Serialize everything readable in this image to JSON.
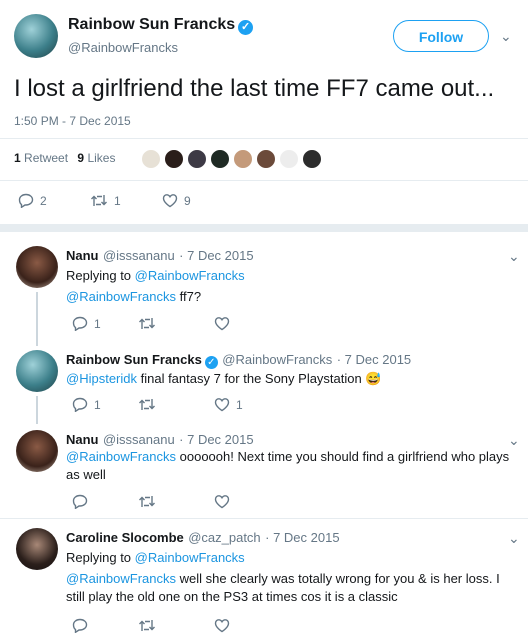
{
  "main_tweet": {
    "display_name": "Rainbow Sun Francks",
    "handle": "@RainbowFrancks",
    "follow_label": "Follow",
    "text": "I lost a girlfriend the last time FF7 came out...",
    "timestamp": "1:50 PM - 7 Dec 2015",
    "retweets_count": "1",
    "retweets_label": "Retweet",
    "likes_count": "9",
    "likes_label": "Likes",
    "actions": {
      "reply": "2",
      "retweet": "1",
      "like": "9"
    }
  },
  "replies": [
    {
      "display_name": "Nanu",
      "handle": "@isssananu",
      "date": "· 7 Dec 2015",
      "replying_prefix": "Replying to",
      "replying_to": "@RainbowFrancks",
      "mention": "@RainbowFrancks",
      "text": " ff7?",
      "actions": {
        "reply": "1",
        "retweet": "",
        "like": ""
      }
    },
    {
      "display_name": "Rainbow Sun Francks",
      "handle": "@RainbowFrancks",
      "date": "· 7 Dec 2015",
      "mention": "@Hipsteridk",
      "text": " final fantasy 7 for the Sony Playstation",
      "emoji": "😅",
      "actions": {
        "reply": "1",
        "retweet": "",
        "like": "1"
      }
    },
    {
      "display_name": "Nanu",
      "handle": "@isssananu",
      "date": "· 7 Dec 2015",
      "mention": "@RainbowFrancks",
      "text": " ooooooh! Next time you should find a girlfriend who plays as well",
      "actions": {
        "reply": "",
        "retweet": "",
        "like": ""
      }
    },
    {
      "display_name": "Caroline Slocombe",
      "handle": "@caz_patch",
      "date": "· 7 Dec 2015",
      "replying_prefix": "Replying to",
      "replying_to": "@RainbowFrancks",
      "mention": "@RainbowFrancks",
      "text": " well she clearly was totally wrong for you & is her loss. I still play the old one on the PS3 at times cos it is a classic",
      "actions": {
        "reply": "",
        "retweet": "",
        "like": ""
      }
    }
  ],
  "colors": {
    "accent": "#1da1f2",
    "link": "#1b95e0",
    "muted": "#657786",
    "divider": "#e6ecf0"
  }
}
